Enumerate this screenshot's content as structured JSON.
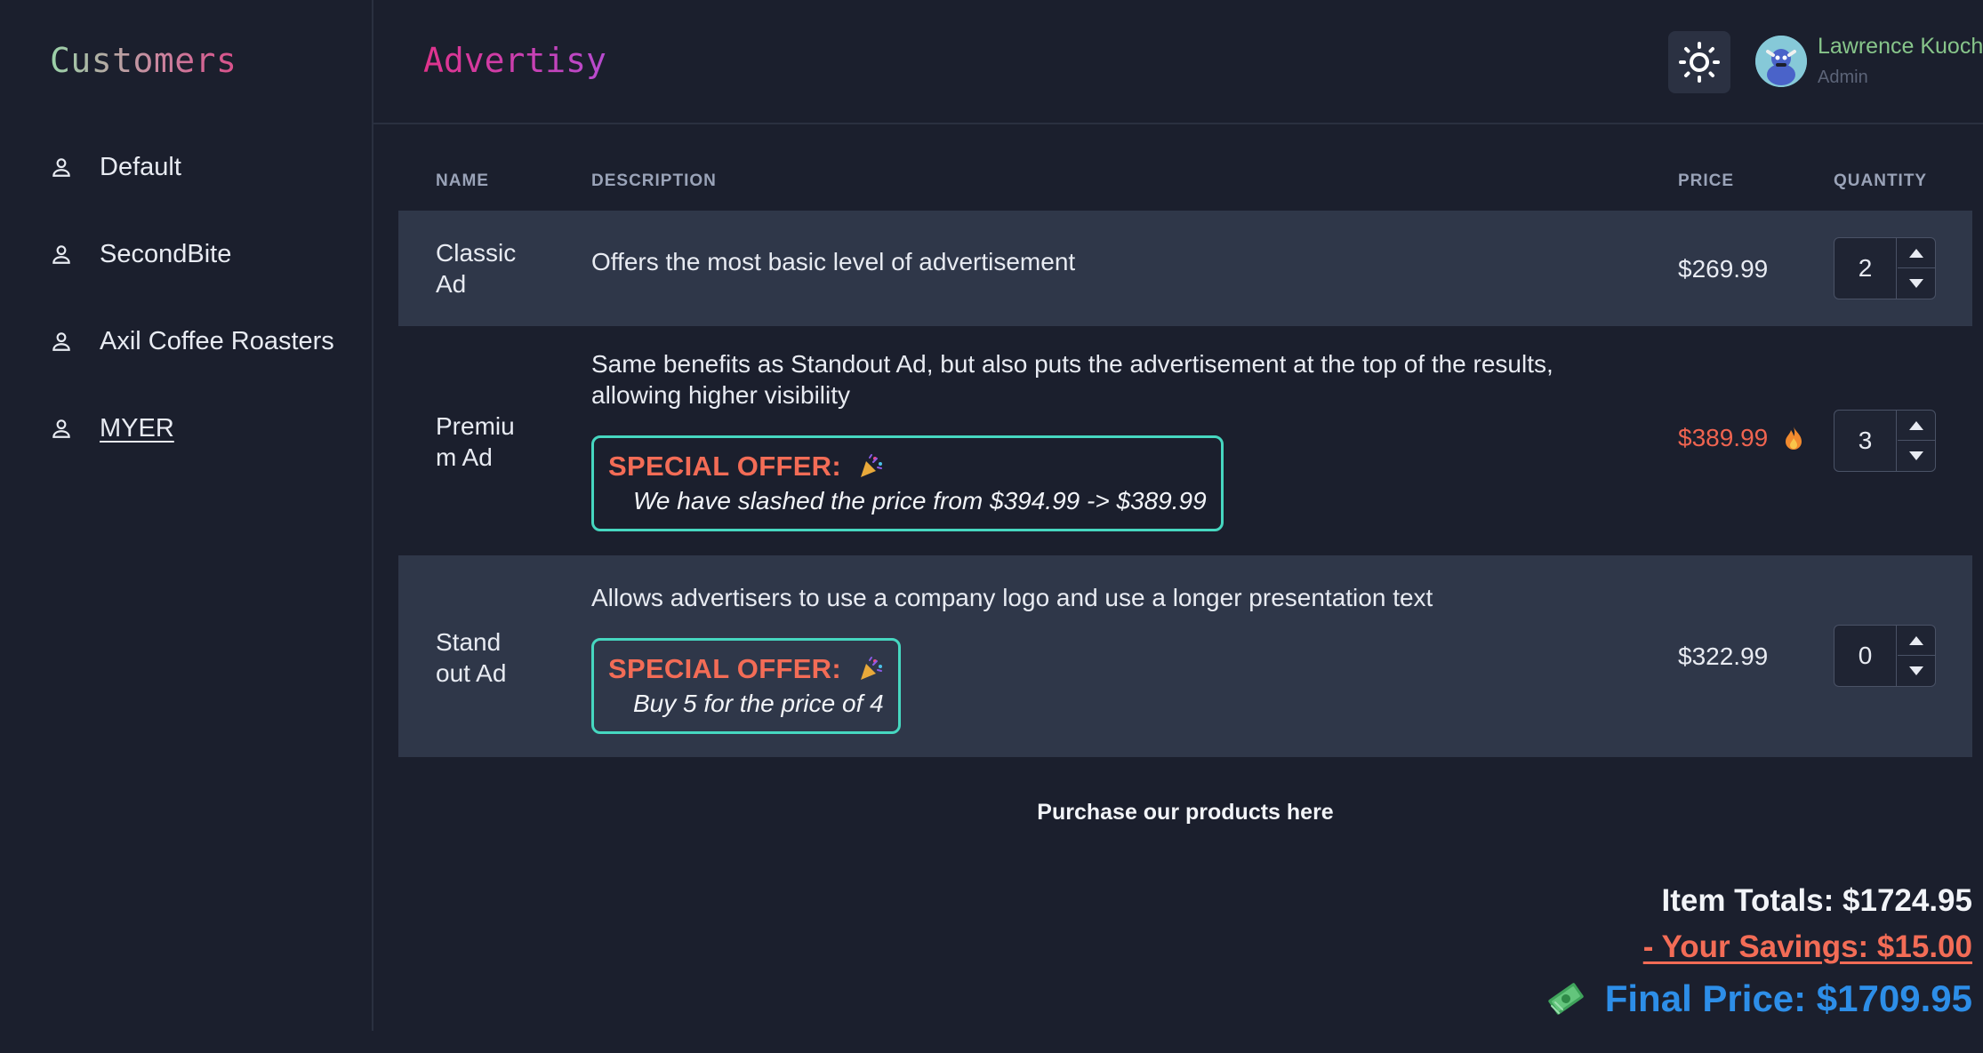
{
  "sidebar": {
    "title": "Customers",
    "items": [
      {
        "label": "Default",
        "icon": "user-icon"
      },
      {
        "label": "SecondBite",
        "icon": "user-icon"
      },
      {
        "label": "Axil Coffee Roasters",
        "icon": "user-icon"
      },
      {
        "label": "MYER",
        "icon": "user-icon",
        "active": true
      }
    ]
  },
  "header": {
    "brand": "Advertisy",
    "theme_toggle_icon": "sun-icon",
    "user": {
      "name": "Lawrence Kuoch",
      "role": "Admin"
    }
  },
  "table": {
    "columns": {
      "name": "NAME",
      "description": "DESCRIPTION",
      "price": "PRICE",
      "quantity": "QUANTITY"
    },
    "rows": [
      {
        "name_line1": "Classic",
        "name_line2": "Ad",
        "description": "Offers the most basic level of advertisement",
        "price": "$269.99",
        "quantity": "2"
      },
      {
        "name_line1": "Premiu",
        "name_line2": "m Ad",
        "description_line1": "Same benefits as Standout Ad, but also puts the advertisement at the top of the results,",
        "description_line2": "allowing higher visibility",
        "offer_title": "SPECIAL OFFER:",
        "offer_text": "We have slashed the price from $394.99 -> $389.99",
        "price": "$389.99",
        "price_icon": "fire-icon",
        "quantity": "3"
      },
      {
        "name_line1": "Stand",
        "name_line2": "out Ad",
        "description": "Allows advertisers to use a company logo and use a longer presentation text",
        "offer_title": "SPECIAL OFFER:",
        "offer_text": "Buy 5 for the price of 4",
        "price": "$322.99",
        "quantity": "0"
      }
    ]
  },
  "purchase_link": "Purchase our products here",
  "totals": {
    "item_totals": "Item Totals: $1724.95",
    "savings": "- Your Savings: $15.00",
    "final_price": "Final Price: $1709.95",
    "final_icon": "money-icon"
  },
  "colors": {
    "background": "#1b1f2d",
    "row_shade": "#2f3749",
    "offer_border": "#46d7c0",
    "offer_title": "#f36c56",
    "final_price": "#2d8ee8",
    "user_name": "#87c58a"
  }
}
